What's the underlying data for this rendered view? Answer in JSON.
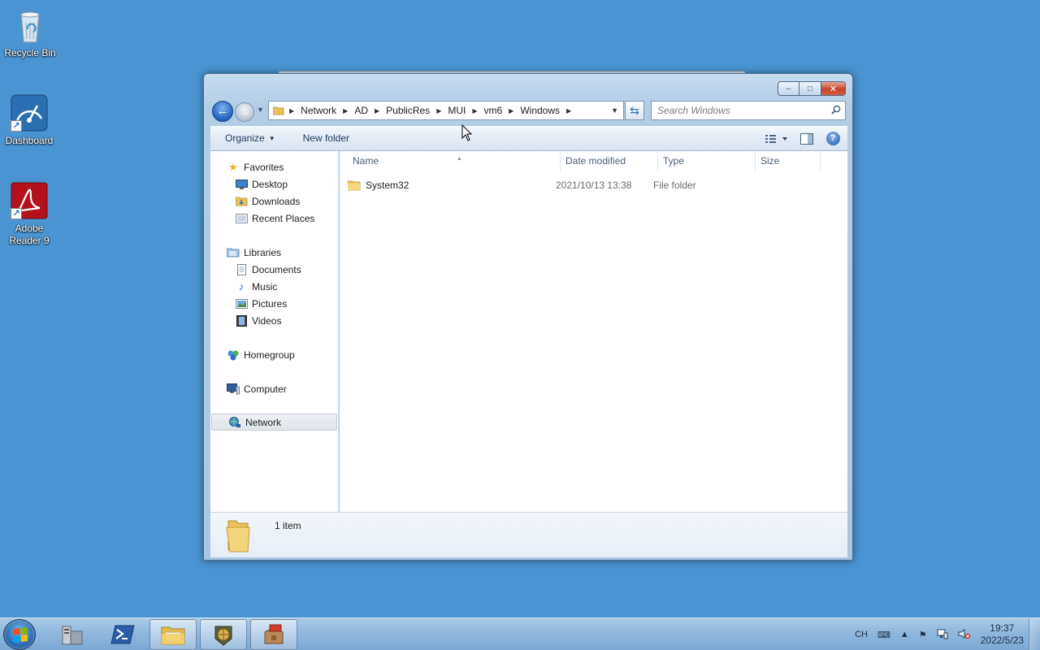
{
  "desktop": {
    "icons": [
      {
        "label": "Recycle Bin",
        "icon": "recycle-bin-icon"
      },
      {
        "label": "Dashboard",
        "icon": "dashboard-icon"
      },
      {
        "label": "Adobe Reader 9",
        "icon": "adobe-reader-icon"
      }
    ]
  },
  "window": {
    "caption_buttons": {
      "minimize": "–",
      "maximize": "□",
      "close": "✕"
    },
    "nav": {
      "back": "←",
      "forward": "→",
      "breadcrumbs": [
        "Network",
        "AD",
        "PublicRes",
        "MUI",
        "vm6",
        "Windows"
      ],
      "search_placeholder": "Search Windows"
    },
    "toolbar": {
      "organize": "Organize",
      "new_folder": "New folder"
    },
    "nav_pane": {
      "favorites": {
        "label": "Favorites",
        "items": [
          "Desktop",
          "Downloads",
          "Recent Places"
        ]
      },
      "libraries": {
        "label": "Libraries",
        "items": [
          "Documents",
          "Music",
          "Pictures",
          "Videos"
        ]
      },
      "homegroup": "Homegroup",
      "computer": "Computer",
      "network": "Network"
    },
    "columns": {
      "name": "Name",
      "date": "Date modified",
      "type": "Type",
      "size": "Size"
    },
    "files": [
      {
        "name": "System32",
        "date": "2021/10/13 13:38",
        "type": "File folder",
        "size": ""
      }
    ],
    "details": {
      "count": "1 item"
    }
  },
  "taskbar": {
    "buttons": [
      "server-manager-icon",
      "powershell-icon",
      "explorer-icon",
      "network-tool-icon",
      "archive-tool-icon"
    ],
    "tray": {
      "lang": "CH",
      "time": "19:37",
      "date": "2022/5/23"
    }
  },
  "colors": {
    "desktop": "#4a94d2",
    "accent": "#2a64c8",
    "selected_nav": "#dfe4ea"
  }
}
